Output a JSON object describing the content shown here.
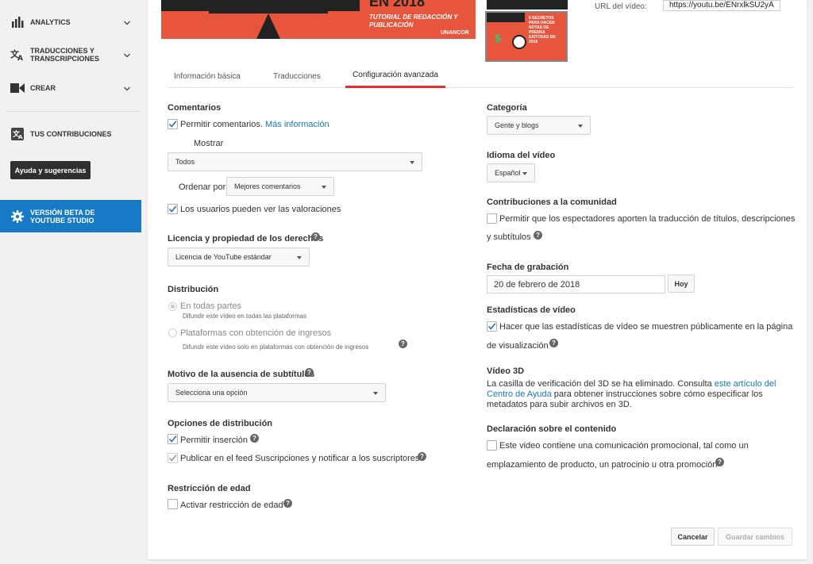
{
  "sidebar": {
    "analytics": "ANALYTICS",
    "translations": "TRADUCCIONES Y TRANSCRIPCIONES",
    "create": "CREAR",
    "contributions": "TUS CONTRIBUCIONES",
    "help": "Ayuda y sugerencias",
    "beta": "VERSIÓN BETA DE YOUTUBE STUDIO"
  },
  "thumbnail": {
    "title_fragment": "EN 2018",
    "subtitle": "TUTORIAL DE REDACCIÓN Y PUBLICACIÓN",
    "brand": "UNANCOR",
    "selected_text": "5 SECRETOS PARA HACER NOTAS DE PRENSA EXITOSAS EN 2018",
    "dollar": "$"
  },
  "url": {
    "label": "URL del vídeo:",
    "value": "https://youtu.be/ENrxlkSU2yA"
  },
  "tabs": [
    "Información básica",
    "Traducciones",
    "Configuración avanzada"
  ],
  "left": {
    "comments": {
      "title": "Comentarios",
      "allow": "Permitir comentarios.",
      "more_info": "Más información",
      "show_label": "Mostrar",
      "show_value": "Todos",
      "order_label": "Ordenar por",
      "order_value": "Mejores comentarios",
      "ratings": "Los usuarios pueden ver las valoraciones"
    },
    "license": {
      "title": "Licencia y propiedad de los derechos",
      "value": "Licencia de YouTube estándar"
    },
    "distribution": {
      "title": "Distribución",
      "everywhere": "En todas partes",
      "everywhere_sub": "Difundir este vídeo en todas las plataformas",
      "monetized": "Plataformas con obtención de ingresos",
      "monetized_sub": "Difundir este vídeo solo en plataformas con obtención de ingresos"
    },
    "subtitles": {
      "title": "Motivo de la ausencia de subtítulos",
      "value": "Selecciona una opción"
    },
    "options": {
      "title": "Opciones de distribución",
      "embed": "Permitir inserción",
      "feed": "Publicar en el feed Suscripciones y notificar a los suscriptores"
    },
    "age": {
      "title": "Restricción de edad",
      "enable": "Activar restricción de edad"
    }
  },
  "right": {
    "category": {
      "title": "Categoría",
      "value": "Gente y blogs"
    },
    "language": {
      "title": "Idioma del vídeo",
      "value": "Español"
    },
    "community": {
      "title": "Contribuciones a la comunidad",
      "line1": "Permitir que los espectadores aporten la traducción de títulos, descripciones",
      "line2": "y subtítulos"
    },
    "recording": {
      "title": "Fecha de grabación",
      "value": "20 de febrero de 2018",
      "today": "Hoy"
    },
    "stats": {
      "title": "Estadísticas de vídeo",
      "line1": "Hacer que las estadísticas de vídeo se muestren públicamente en la página",
      "line2": "de visualización"
    },
    "video3d": {
      "title": "Vídeo 3D",
      "l1a": "La casilla de verificación del 3D se ha eliminado. Consulta ",
      "l1b": "este artículo del",
      "l2a": "Centro de Ayuda",
      "l2b": " para obtener instrucciones sobre cómo especificar los",
      "l3": "metadatos para subir archivos en 3D."
    },
    "declaration": {
      "title": "Declaración sobre el contenido",
      "line1": "Este video contiene una comunicación promocional, tal como un",
      "line2": "emplazamiento de producto, un patrocinio u otra promoción"
    }
  },
  "actions": {
    "cancel": "Cancelar",
    "save": "Guardar cambios"
  },
  "colors": {
    "accent": "#167ac6",
    "tab_underline": "#e52d27",
    "thumb": "#e8553d"
  }
}
